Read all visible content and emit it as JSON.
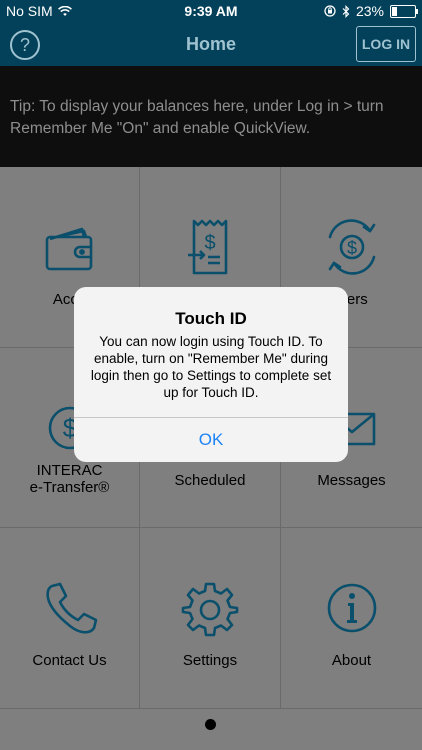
{
  "status_bar": {
    "carrier": "No SIM",
    "time": "9:39 AM",
    "battery": "23%",
    "battery_level": 0.23,
    "icons": [
      "wifi-icon",
      "orientation-lock-icon",
      "bluetooth-icon",
      "battery-icon"
    ]
  },
  "nav": {
    "help": "?",
    "title": "Home",
    "login": "LOG IN"
  },
  "tip": {
    "line1": "Tip: To display your balances here, under Log in > turn",
    "line2": "Remember Me \"On\" and enable QuickView."
  },
  "tiles": [
    {
      "label": "Acco",
      "icon": "wallet-icon"
    },
    {
      "label": "",
      "icon": "bill-payment-icon"
    },
    {
      "label": "sfers",
      "icon": "transfer-icon"
    },
    {
      "label_line1": "INTERAC",
      "label_line2": "e-Transfer®",
      "icon": "etransfer-dollar-icon"
    },
    {
      "label": "Scheduled",
      "icon": "calendar-icon"
    },
    {
      "label": "Messages",
      "icon": "envelope-icon"
    },
    {
      "label": "Contact Us",
      "icon": "phone-icon"
    },
    {
      "label": "Settings",
      "icon": "gear-icon"
    },
    {
      "label": "About",
      "icon": "info-icon"
    }
  ],
  "alert": {
    "title": "Touch ID",
    "message": "You can now login using Touch ID. To enable, turn on \"Remember Me\" during login then go to Settings to complete set up for Touch ID.",
    "ok": "OK"
  },
  "colors": {
    "header": "#03415a",
    "icon": "#0a4f6b",
    "dim_overlay": "#7f7f7f",
    "ok_blue": "#1d84f7"
  }
}
